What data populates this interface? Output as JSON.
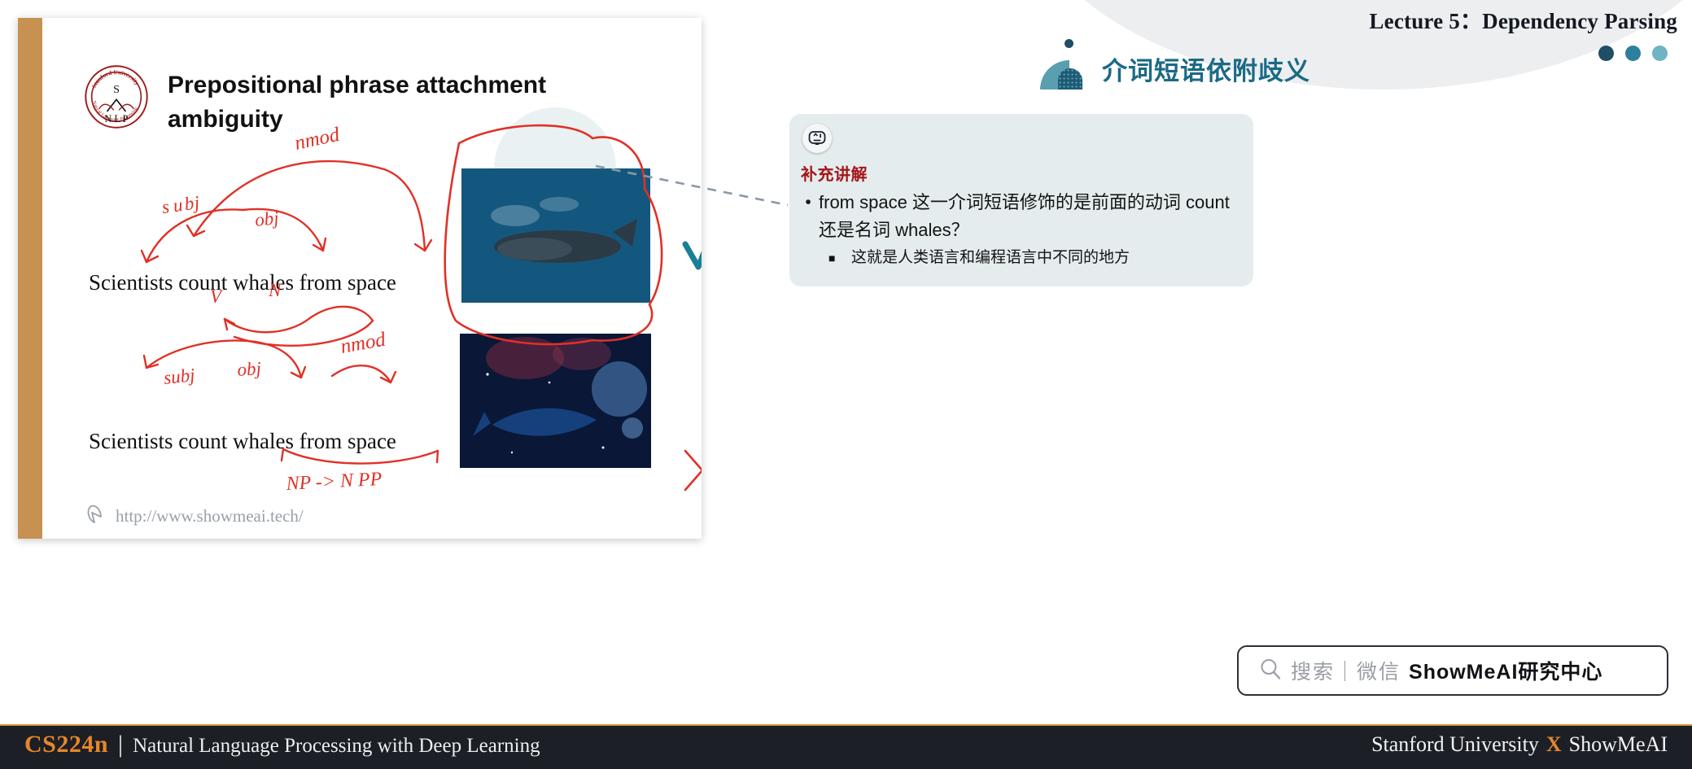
{
  "header": {
    "lecture_title": "Lecture 5：Dependency Parsing",
    "section_title": "介词短语依附歧义",
    "dot_colors": [
      "#1f4e66",
      "#2d7f9c",
      "#6fb3c4"
    ]
  },
  "callout": {
    "icon": "ai-robot-icon",
    "heading": "补充讲解",
    "bullet_marker": "•",
    "bullet_text": "from space 这一介词短语修饰的是前面的动词 count 还是名词 whales？",
    "sub_marker": "■",
    "sub_text": "这就是人类语言和编程语言中不同的地方",
    "background": "#e4ecee",
    "heading_color": "#a4161a"
  },
  "search": {
    "icon": "search-icon",
    "placeholder_text": "搜索｜微信",
    "brand_text": "ShowMeAI研究中心"
  },
  "footer": {
    "course_code": "CS224n",
    "divider": "|",
    "course_name": "Natural Language Processing with Deep Learning",
    "right_prefix": "Stanford University",
    "right_x": "X",
    "right_brand": "ShowMeAI",
    "accent_color": "#e8862a",
    "background": "#1c1f26"
  },
  "slide": {
    "logo_alt": "stanford-nlp-logo",
    "logo_top_text": "Stanford University",
    "logo_letter_s": "S",
    "logo_letters_nlp": "N L P",
    "logo_bottom_text": "Natural Language Processing",
    "title": "Prepositional phrase attachment ambiguity",
    "sentence_1": "Scientists count whales from space",
    "sentence_2": "Scientists count whales from space",
    "url": "http://www.showmeai.tech/",
    "annotations": {
      "row1": [
        "nmod",
        "subj",
        "obj",
        "V",
        "N"
      ],
      "row2": [
        "subj",
        "obj",
        "nmod",
        "NP -> N PP"
      ],
      "check_mark": "✓",
      "cross_mark": "✗"
    },
    "stripe_color": "#c79152",
    "ink_color": "#e03127"
  }
}
